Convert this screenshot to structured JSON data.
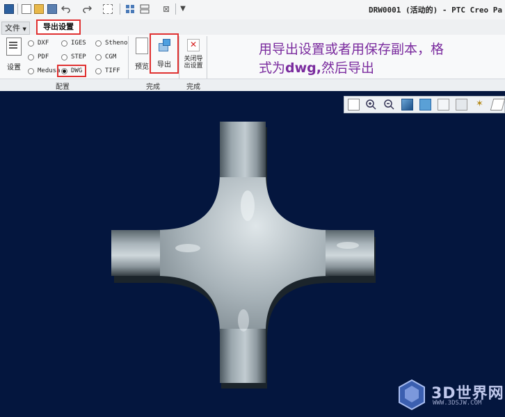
{
  "window": {
    "title": "DRW0001 (活动的) - PTC Creo Pa"
  },
  "quick_access": {
    "icons": [
      "window-icon",
      "new-file-icon",
      "open-folder-icon",
      "save-icon",
      "undo-icon",
      "redo-icon",
      "regenerate-icon",
      "windows-icon",
      "close-window-icon",
      "customize-icon"
    ]
  },
  "tabs": {
    "file_label": "文件",
    "export_setup_label": "导出设置"
  },
  "ribbon": {
    "setting_label": "设置",
    "formats": [
      {
        "label": "DXF",
        "selected": false
      },
      {
        "label": "IGES",
        "selected": false
      },
      {
        "label": "Stheno",
        "selected": false
      },
      {
        "label": "PDF",
        "selected": false
      },
      {
        "label": "STEP",
        "selected": false
      },
      {
        "label": "CGM",
        "selected": false
      },
      {
        "label": "Medusa",
        "selected": false
      },
      {
        "label": "DWG",
        "selected": true
      },
      {
        "label": "TIFF",
        "selected": false
      }
    ],
    "preview_label": "预览",
    "export_label": "导出",
    "close_export_label_1": "关闭导",
    "close_export_label_2": "出设置",
    "group_config": "配置",
    "group_finish": "完成",
    "group_finish2": "完成"
  },
  "annotation": {
    "line1": "用导出设置或者用保存副本，格",
    "line2_prefix": "式为",
    "line2_bold": "dwg,",
    "line2_suffix": "然后导出",
    "color": "#7a2b9e"
  },
  "graphics": {
    "background": "#04163e"
  },
  "watermark": {
    "text": "3D世界网",
    "sub": "WWW.3DSJW.COM"
  }
}
